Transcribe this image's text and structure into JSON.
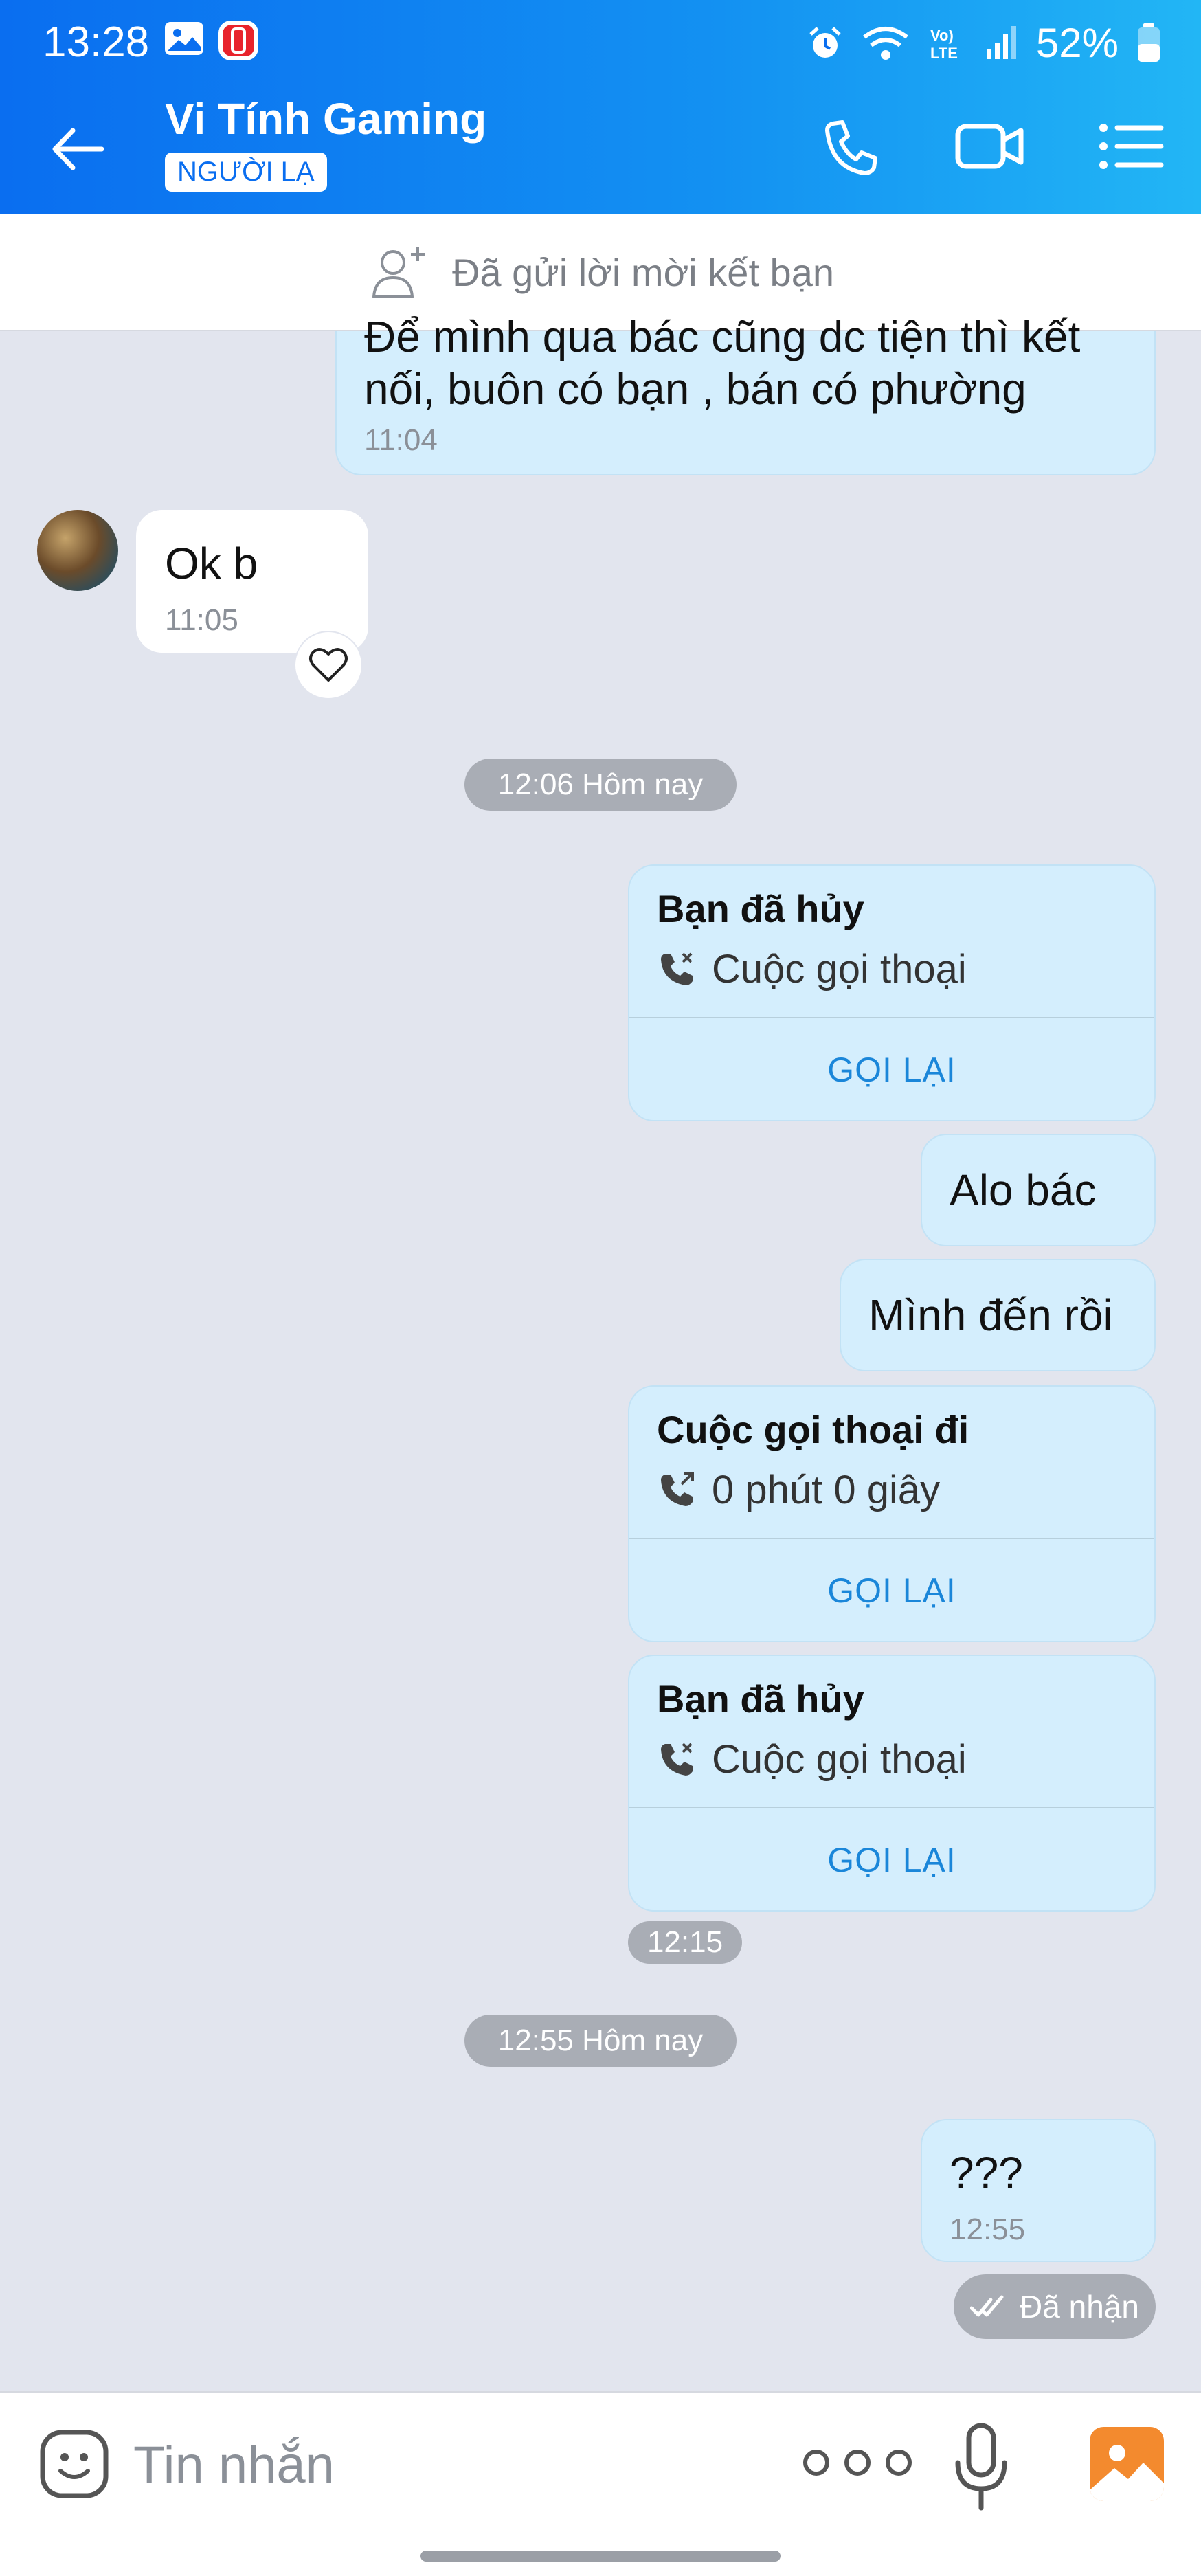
{
  "status_bar": {
    "time": "13:28",
    "battery": "52%"
  },
  "header": {
    "title": "Vi Tính Gaming",
    "badge": "NGƯỜI LẠ"
  },
  "friend_bar": {
    "text": "Đã gửi lời mời kết bạn"
  },
  "messages": {
    "m1": {
      "line1": "Để mình qua bác cũng dc tiện thì kết",
      "line2": "nối, buôn có bạn , bán có phường",
      "time": "11:04"
    },
    "m2": {
      "text": "Ok b",
      "time": "11:05"
    },
    "sep1": "12:06 Hôm nay",
    "call1": {
      "title": "Bạn đã hủy",
      "detail": "Cuộc gọi thoại",
      "action": "GỌI LẠI"
    },
    "m3": "Alo bác",
    "m4": "Mình đến rồi",
    "call2": {
      "title": "Cuộc gọi thoại đi",
      "detail": "0 phút 0 giây",
      "action": "GỌI LẠI"
    },
    "call3": {
      "title": "Bạn đã hủy",
      "detail": "Cuộc gọi thoại",
      "action": "GỌI LẠI"
    },
    "time_1215": "12:15",
    "sep2": "12:55 Hôm nay",
    "m5": {
      "text": "???",
      "time": "12:55"
    },
    "status": "Đã nhận"
  },
  "composer": {
    "placeholder": "Tin nhắn"
  },
  "colors": {
    "header_start": "#0a6ef0",
    "header_end": "#22b6f5",
    "outgoing_bubble": "#d4eefd",
    "chat_background": "#e2e5ee",
    "link_blue": "#1a86d9"
  }
}
